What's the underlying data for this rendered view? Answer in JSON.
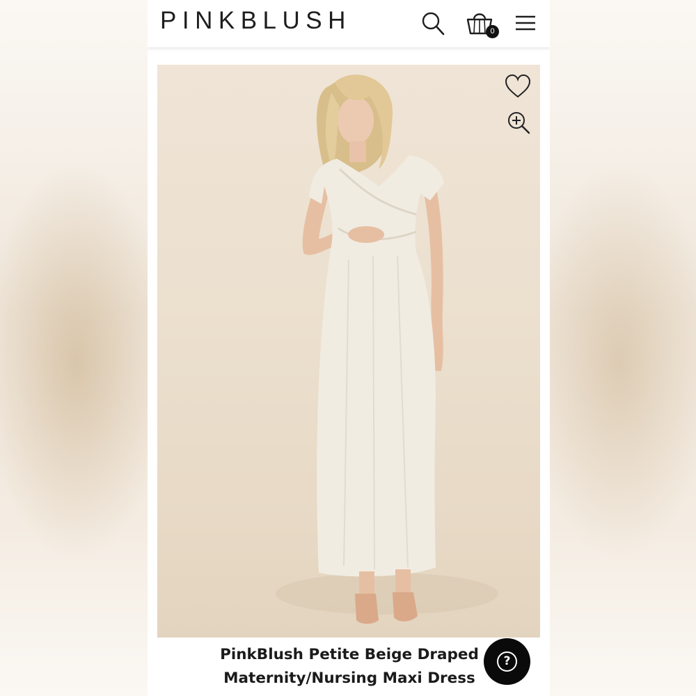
{
  "header": {
    "logo": "PINKBLUSH",
    "cart_count": "0",
    "icons": [
      "search-icon",
      "shopping-bag-icon",
      "menu-icon"
    ]
  },
  "product": {
    "title_line1": "PinkBlush Petite Beige Draped",
    "title_line2": "Maternity/Nursing Maxi Dress",
    "image_icons": [
      "heart-icon",
      "zoom-in-icon"
    ]
  },
  "help": {
    "icon": "question-mark-icon",
    "glyph": "?"
  },
  "colors": {
    "brand_text": "#1e1e1e",
    "photo_background": "#ece0cf",
    "help_button": "#0a0a0a"
  }
}
